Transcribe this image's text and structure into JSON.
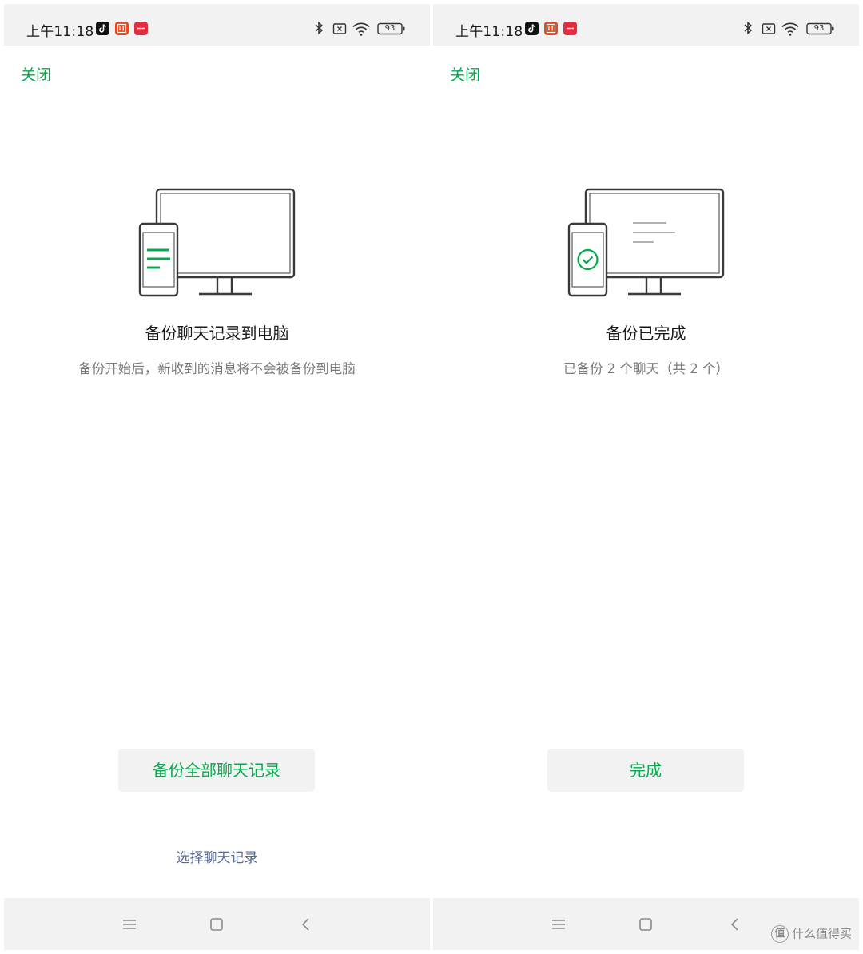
{
  "colors": {
    "accent_green": "#07a94f",
    "link_blue": "#576b95",
    "bar_gray": "#f2f2f2",
    "text_dark": "#1a1a1a",
    "text_gray": "#7a7a7a"
  },
  "status_bar": {
    "time": "上午11:18",
    "battery": "93",
    "app_icons": [
      "tiktok-icon",
      "ting-icon",
      "red-app-icon"
    ],
    "system_icons": [
      "bluetooth-icon",
      "sim-off-icon",
      "wifi-icon",
      "battery-icon"
    ]
  },
  "left_screen": {
    "close_label": "关闭",
    "title": "备份聊天记录到电脑",
    "subtitle": "备份开始后，新收到的消息将不会被备份到电脑",
    "primary_button": "备份全部聊天记录",
    "secondary_link": "选择聊天记录",
    "illustration_icon": "phone-to-monitor-icon"
  },
  "right_screen": {
    "close_label": "关闭",
    "title": "备份已完成",
    "subtitle": "已备份 2 个聊天（共 2 个）",
    "primary_button": "完成",
    "illustration_icon": "backup-complete-check-icon"
  },
  "nav_bar": {
    "keys": [
      "menu-icon",
      "home-icon",
      "back-icon"
    ]
  },
  "watermark": {
    "logo_char": "值",
    "text": "什么值得买"
  }
}
